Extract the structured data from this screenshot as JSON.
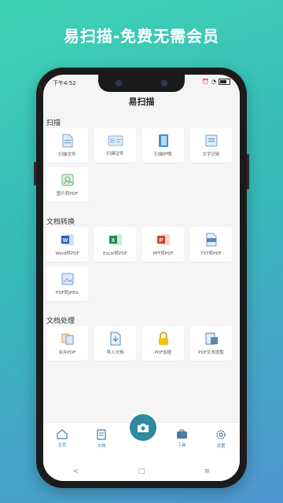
{
  "headline": "易扫描-免费无需会员",
  "status": {
    "time": "下午4:52"
  },
  "app_title": "易扫描",
  "sections": {
    "scan": {
      "title": "扫描",
      "items": [
        "扫描文件",
        "扫描证件",
        "扫描护照",
        "文字识别",
        "图片转PDF"
      ]
    },
    "convert": {
      "title": "文档转换",
      "items": [
        "Word转PDF",
        "Excel转PDF",
        "PPT转PDF",
        "TXT转PDF",
        "PDF转JPEG"
      ]
    },
    "process": {
      "title": "文档处理",
      "items": [
        "合并PDF",
        "导入文档",
        "PDF加密",
        "PDF文本提取"
      ]
    }
  },
  "tabs": [
    "主页",
    "文档",
    "工具",
    "设置"
  ],
  "nav": {
    "back": "<",
    "home": "□",
    "menu": "≡"
  },
  "colors": {
    "accent": "#2e8a9e",
    "tab_text": "#4a7aa0"
  }
}
